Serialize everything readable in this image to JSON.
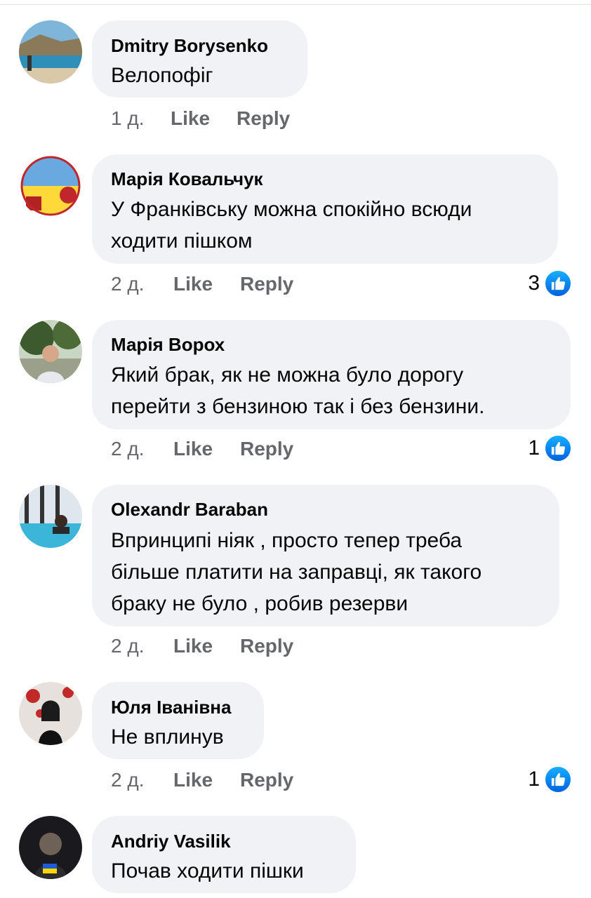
{
  "comments": [
    {
      "author": "Dmitry Borysenko",
      "lines": [
        "Велопофіг"
      ],
      "time": "1 д.",
      "like": "Like",
      "reply": "Reply",
      "reactions": ""
    },
    {
      "author": "Марія Ковальчук",
      "lines": [
        "У Франківську можна спокійно всюди",
        "ходити пішком"
      ],
      "time": "2 д.",
      "like": "Like",
      "reply": "Reply",
      "reactions": "3"
    },
    {
      "author": "Марія Ворох",
      "lines": [
        "Який брак, як не можна було дорогу",
        "перейти з бензиною так і без бензини."
      ],
      "time": "2 д.",
      "like": "Like",
      "reply": "Reply",
      "reactions": "1"
    },
    {
      "author": "Olexandr Baraban",
      "lines": [
        "Впринципі ніяк , просто тепер треба",
        "більше платити на заправці, як такого",
        "браку не було , робив резерви"
      ],
      "time": "2 д.",
      "like": "Like",
      "reply": "Reply",
      "reactions": ""
    },
    {
      "author": "Юля Іванівна",
      "lines": [
        "Не вплинув"
      ],
      "time": "2 д.",
      "like": "Like",
      "reply": "Reply",
      "reactions": "1"
    },
    {
      "author": "Andriy Vasilik",
      "lines": [
        "Почав ходити пішки"
      ],
      "time": "",
      "like": "",
      "reply": "",
      "reactions": ""
    }
  ],
  "icons": {
    "like": "thumbs-up-icon"
  },
  "colors": {
    "bubble": "#f0f2f5",
    "meta": "#65676b",
    "like_blue": "#1877f2"
  }
}
